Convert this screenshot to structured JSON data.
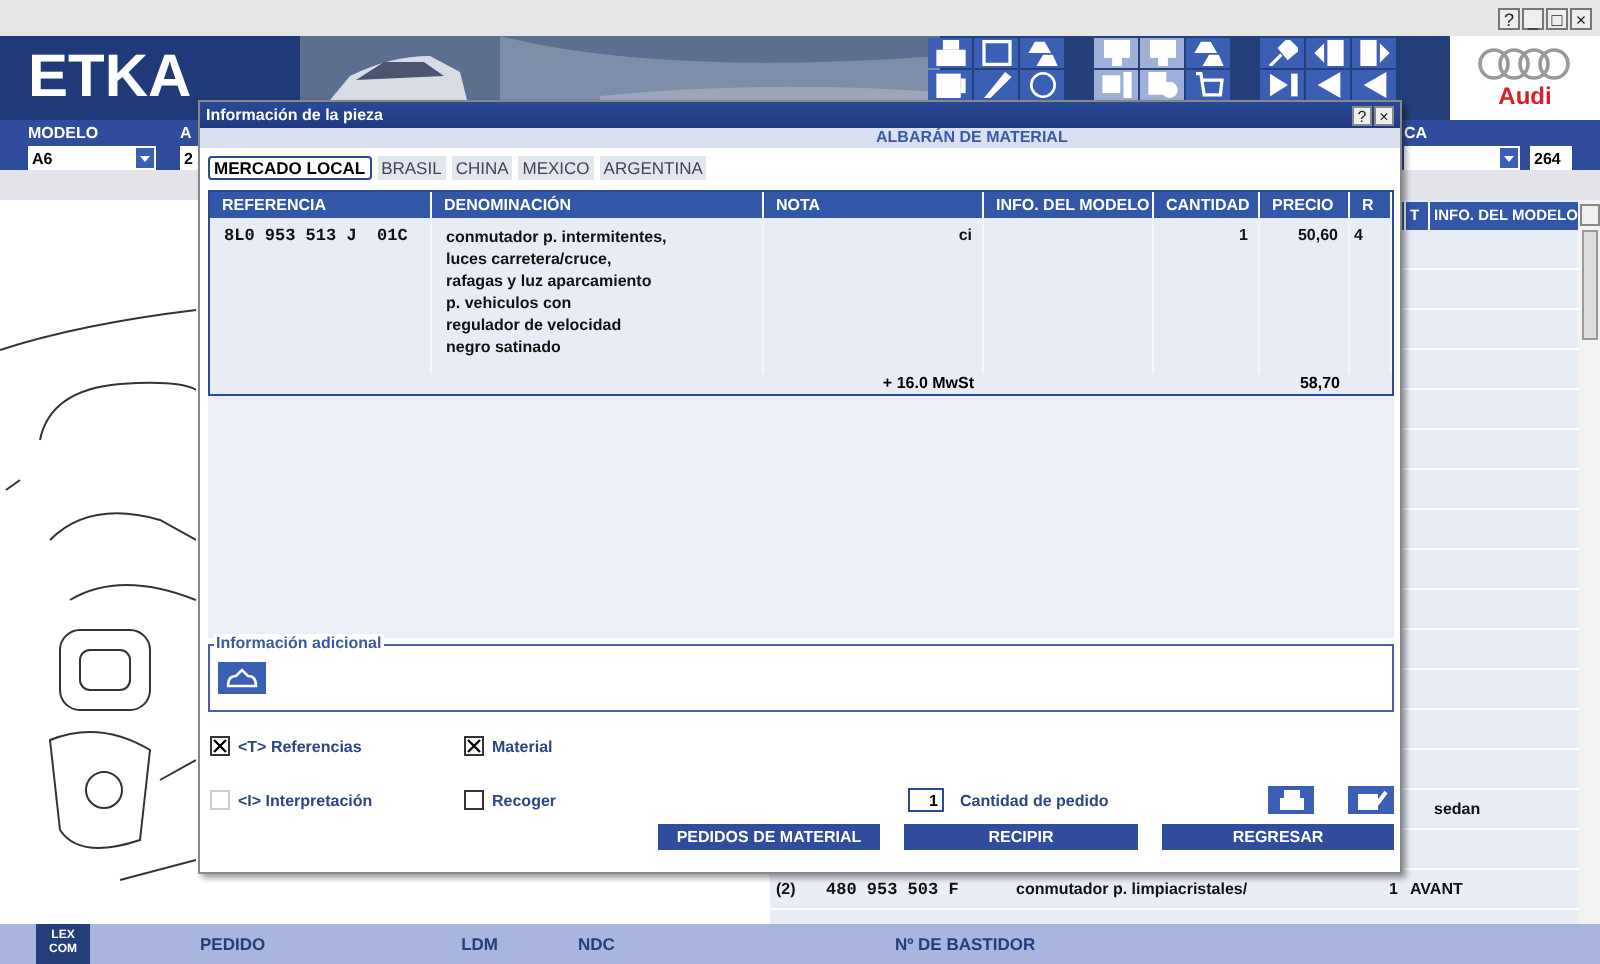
{
  "window": {
    "controls": [
      "?",
      "_",
      "□",
      "×"
    ]
  },
  "header": {
    "logo": "ETKA",
    "brand": "Audi"
  },
  "toolbar": [
    [
      {
        "disabled": false
      },
      {
        "disabled": false
      },
      {
        "disabled": false
      },
      {
        "disabled": false
      },
      {
        "disabled": false
      },
      {
        "disabled": false
      }
    ],
    [
      {
        "disabled": true
      },
      {
        "disabled": true
      },
      {
        "disabled": false
      },
      {
        "disabled": true
      },
      {
        "disabled": true
      },
      {
        "disabled": false
      }
    ],
    [
      {
        "disabled": false
      },
      {
        "disabled": false
      },
      {
        "disabled": false
      },
      {
        "disabled": false
      },
      {
        "disabled": false
      },
      {
        "disabled": false
      }
    ]
  ],
  "filters": [
    {
      "label": "MODELO",
      "kind": "combo",
      "value": "A6"
    },
    {
      "label": "A",
      "kind": "text",
      "value": "2"
    },
    {
      "label": "CA",
      "kind": "combo"
    }
  ],
  "counter": "264",
  "parts_table": {
    "columns": [
      "T",
      "INFO. DEL MODELO"
    ],
    "rows": [
      {
        "info": "sedan"
      },
      {
        "column_1": "(2)",
        "column_2": "480 953 503 F",
        "column_3": "conmutador p. limpiacristales/",
        "column_4": "1",
        "column_5": "AVANT"
      }
    ]
  },
  "dialog": {
    "title": "Información de la pieza",
    "controls": [
      "?",
      "×"
    ],
    "subtitle": "ALBARÁN DE MATERIAL",
    "tabs": [
      {
        "label": "MERCADO LOCAL",
        "selected": true
      },
      {
        "label": "BRASIL",
        "selected": false
      },
      {
        "label": "CHINA",
        "selected": false
      },
      {
        "label": "MEXICO",
        "selected": false
      },
      {
        "label": "ARGENTINA",
        "selected": false
      }
    ],
    "table": {
      "columns": [
        "REFERENCIA",
        "DENOMINACIÓN",
        "NOTA",
        "INFO. DEL MODELO",
        "CANTIDAD",
        "PRECIO",
        "R"
      ],
      "rows": [
        {
          "referencia": "8L0 953 513 J  01C",
          "denominacion": [
            "conmutador p. intermitentes,",
            "luces carretera/cruce,",
            "rafagas y luz aparcamiento",
            "p. vehiculos con",
            "regulador de velocidad",
            "negro satinado"
          ],
          "nota": "ci",
          "cantidad": "1",
          "precio": "50,60",
          "r": "4"
        }
      ],
      "tax_label": "+ 16.0 MwSt",
      "total": "58,70"
    },
    "additional_info": {
      "label": "Información adicional"
    },
    "options": [
      {
        "label": "<T> Referencias",
        "checked": true,
        "disabled": false
      },
      {
        "label": "Material",
        "checked": true,
        "disabled": false
      },
      {
        "label": "<I> Interpretación",
        "checked": false,
        "disabled": true
      },
      {
        "label": "Recoger",
        "checked": false,
        "disabled": false
      }
    ],
    "quantity": {
      "value": "1",
      "label": "Cantidad de pedido"
    },
    "buttons": [
      "PEDIDOS DE MATERIAL",
      "RECIPIR",
      "REGRESAR"
    ]
  },
  "status_bar": {
    "logo": [
      "LEX",
      "COM"
    ],
    "items": [
      "PEDIDO",
      "LDM",
      "NDC",
      "Nº DE BASTIDOR"
    ]
  }
}
